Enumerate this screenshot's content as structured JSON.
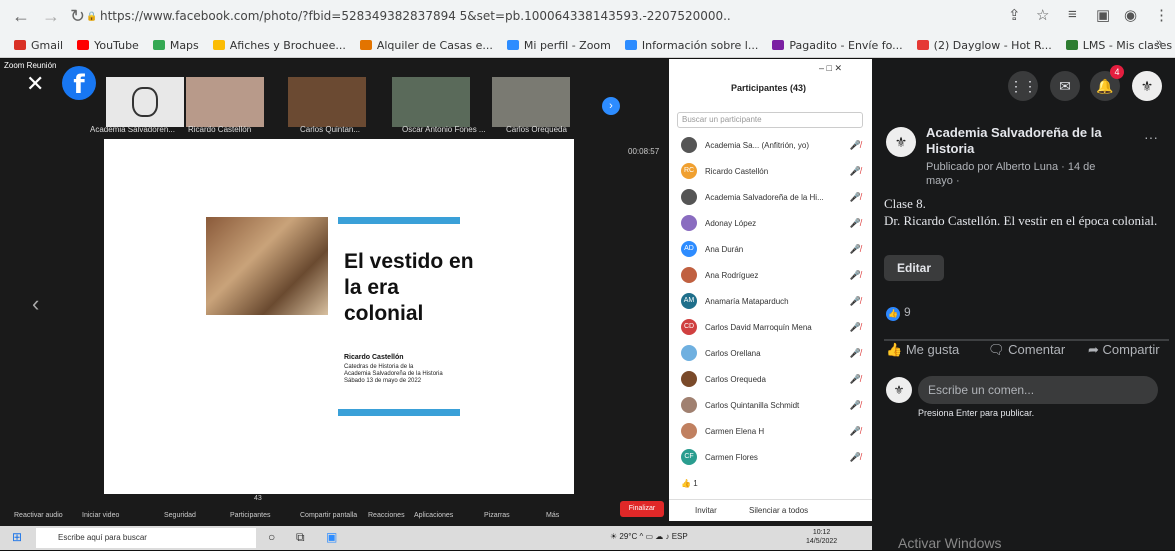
{
  "browser": {
    "url": "https://www.facebook.com/photo/?fbid=528349382837894 5&set=pb.100064338143593.-2207520000..",
    "bookmarks": [
      "Gmail",
      "YouTube",
      "Maps",
      "Afiches y Brochuee...",
      "Alquiler de Casas e...",
      "Mi perfil - Zoom",
      "Información sobre l...",
      "Pagadito - Envíe fo...",
      "(2) Dayglow - Hot R...",
      "LMS - Mis clases"
    ],
    "bookmark_colors": [
      "#d93025",
      "#ff0000",
      "#34a853",
      "#fbbc04",
      "#e37400",
      "#2d8cff",
      "#2d8cff",
      "#7b1fa2",
      "#e53935",
      "#2e7d32"
    ]
  },
  "zoom": {
    "window_title": "Zoom Reunión",
    "thumbnails": [
      {
        "label": "Academia Salvadoreñ..."
      },
      {
        "label": "Ricardo Castellón"
      },
      {
        "label": "Carlos Quintan..."
      },
      {
        "label": "Oscar Antonio Fones ..."
      },
      {
        "label": "Carlos Orequeda"
      }
    ],
    "timer": "00:08:57",
    "slide": {
      "title": "El vestido en la era colonial",
      "author": "Ricardo Castellón",
      "sub1": "Catedras de Historia de la",
      "sub2": "Academia Salvadoreña de la Historia",
      "sub3": "Sábado 13 de mayo de 2022"
    },
    "toolbar": [
      "Reactivar audio",
      "Iniciar video",
      "Seguridad",
      "Participantes",
      "Compartir pantalla",
      "Reacciones",
      "Aplicaciones",
      "Pizarras",
      "Más"
    ],
    "participants_count": "43",
    "end_label": "Finalizar"
  },
  "participants": {
    "title": "Participantes (43)",
    "search_placeholder": "Buscar un participante",
    "list": [
      {
        "initials": "",
        "name": "Academia Sa... (Anfitrión, yo)",
        "color": "#555"
      },
      {
        "initials": "RC",
        "name": "Ricardo Castellón",
        "color": "#f0a030"
      },
      {
        "initials": "",
        "name": "Academia Salvadoreña de la Hi...",
        "color": "#555"
      },
      {
        "initials": "",
        "name": "Adonay López",
        "color": "#8a6cc0"
      },
      {
        "initials": "AD",
        "name": "Ana Durán",
        "color": "#2d8cff"
      },
      {
        "initials": "",
        "name": "Ana Rodríguez",
        "color": "#c06040"
      },
      {
        "initials": "AM",
        "name": "Anamaría Mataparduch",
        "color": "#1f6f8b"
      },
      {
        "initials": "CD",
        "name": "Carlos David Marroquín Mena",
        "color": "#d04040"
      },
      {
        "initials": "",
        "name": "Carlos Orellana",
        "color": "#6fb0e0"
      },
      {
        "initials": "",
        "name": "Carlos Orequeda",
        "color": "#7a4a2a"
      },
      {
        "initials": "",
        "name": "Carlos Quintanilla Schmidt",
        "color": "#a08070"
      },
      {
        "initials": "",
        "name": "Carmen Elena H",
        "color": "#c08060"
      },
      {
        "initials": "CF",
        "name": "Carmen Flores",
        "color": "#2a9d8f"
      }
    ],
    "raised_hands": "1",
    "invite": "Invitar",
    "mute_all": "Silenciar a todos"
  },
  "facebook": {
    "notification_count": "4",
    "page_name": "Academia Salvadoreña de la Historia",
    "posted_by": "Publicado por Alberto Luna · 14 de mayo ·",
    "post_line1": "Clase 8.",
    "post_line2": "Dr. Ricardo Castellón. El vestir en el época colonial.",
    "edit_label": "Editar",
    "likes": "9",
    "like_label": "Me gusta",
    "comment_label": "Comentar",
    "share_label": "Compartir",
    "comment_placeholder": "Escribe un comen...",
    "enter_hint": "Presiona Enter para publicar.",
    "activate_windows": "Activar Windows"
  },
  "taskbar": {
    "search_placeholder": "Escribe aquí para buscar",
    "weather": "29°C",
    "lang": "ESP",
    "time": "10:12",
    "date": "14/5/2022"
  }
}
